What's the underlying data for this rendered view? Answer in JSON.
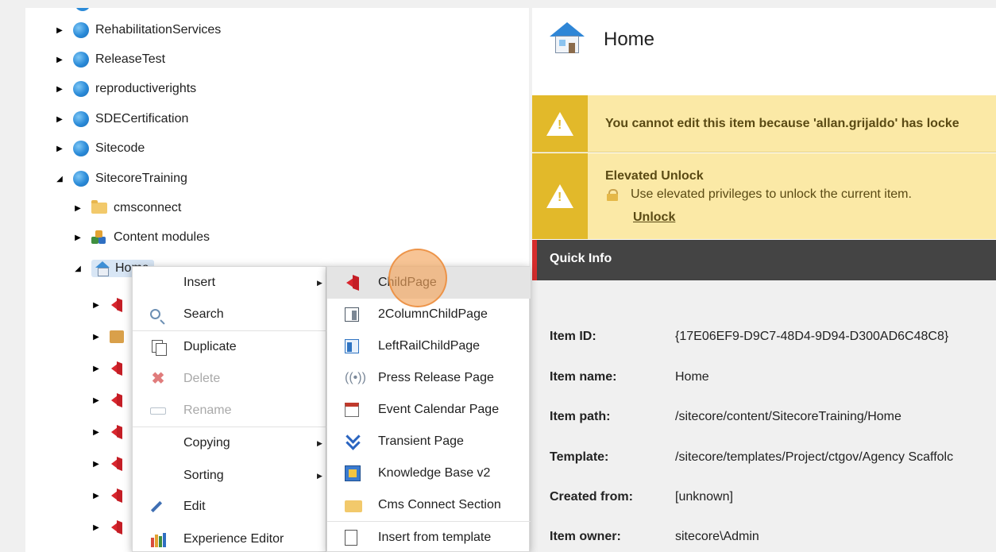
{
  "tree": {
    "items": [
      {
        "label": "RehabilitationServices"
      },
      {
        "label": "ReleaseTest"
      },
      {
        "label": "reproductiverights"
      },
      {
        "label": "SDECertification"
      },
      {
        "label": "Sitecode"
      },
      {
        "label": "SitecoreTraining"
      },
      {
        "label": "cmsconnect"
      },
      {
        "label": "Content modules"
      },
      {
        "label": "Home"
      }
    ],
    "arrow_collapsed": "▶",
    "arrow_expanded": "◢"
  },
  "context_menu": {
    "items": [
      {
        "label": "Insert",
        "icon": "none",
        "submenu": true
      },
      {
        "label": "Search",
        "icon": "search-icon"
      },
      {
        "label": "Duplicate",
        "icon": "duplicate-icon"
      },
      {
        "label": "Delete",
        "icon": "delete-icon",
        "disabled": true
      },
      {
        "label": "Rename",
        "icon": "rename-icon",
        "disabled": true
      },
      {
        "label": "Copying",
        "icon": "none",
        "submenu": true
      },
      {
        "label": "Sorting",
        "icon": "none",
        "submenu": true
      },
      {
        "label": "Edit",
        "icon": "pencil-icon"
      },
      {
        "label": "Experience Editor",
        "icon": "experience-editor-icon"
      }
    ],
    "submenu_arrow": "▶"
  },
  "insert_submenu": {
    "items": [
      {
        "label": "ChildPage",
        "icon": "childpage-icon",
        "highlighted": true
      },
      {
        "label": "2ColumnChildPage",
        "icon": "two-column-icon"
      },
      {
        "label": "LeftRailChildPage",
        "icon": "left-rail-icon"
      },
      {
        "label": "Press Release Page",
        "icon": "press-release-icon"
      },
      {
        "label": "Event Calendar Page",
        "icon": "calendar-icon"
      },
      {
        "label": "Transient Page",
        "icon": "transient-icon"
      },
      {
        "label": "Knowledge Base v2",
        "icon": "knowledge-base-icon"
      },
      {
        "label": "Cms Connect Section",
        "icon": "folder-icon"
      },
      {
        "label": "Insert from template",
        "icon": "template-icon"
      }
    ]
  },
  "detail": {
    "title": "Home",
    "lock_warning": "You cannot edit this item because 'allan.grijaldo' has locke",
    "elevated": {
      "title": "Elevated Unlock",
      "description": "Use elevated privileges to unlock the current item.",
      "unlock_link": "Unlock"
    },
    "quick_info": {
      "heading": "Quick Info",
      "rows": [
        {
          "label": "Item ID:",
          "value": "{17E06EF9-D9C7-48D4-9D94-D300AD6C48C8}"
        },
        {
          "label": "Item name:",
          "value": "Home"
        },
        {
          "label": "Item path:",
          "value": "/sitecore/content/SitecoreTraining/Home"
        },
        {
          "label": "Template:",
          "value": "/sitecore/templates/Project/ctgov/Agency Scaffolc"
        },
        {
          "label": "Created from:",
          "value": "[unknown]"
        },
        {
          "label": "Item owner:",
          "value": "sitecore\\Admin"
        }
      ]
    }
  },
  "colors": {
    "warning_bg": "#fbe9a6",
    "warning_icon_bg": "#e2b92a",
    "quick_info_bar": "#444444",
    "quick_info_accent": "#d62d2d",
    "click_indicator": "#f3a55c"
  }
}
